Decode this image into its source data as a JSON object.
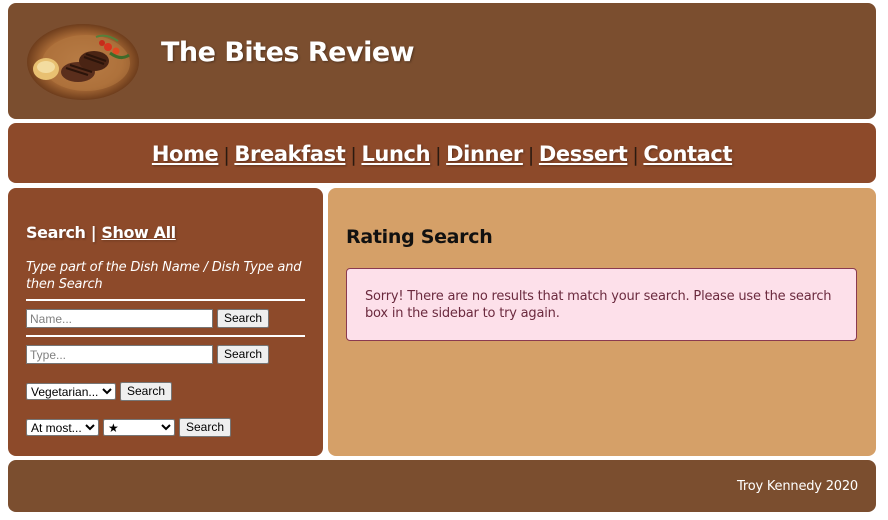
{
  "header": {
    "site_title": "The Bites Review",
    "logo_icon": "steak-plate-logo"
  },
  "nav": {
    "links": [
      "Home",
      "Breakfast",
      "Lunch",
      "Dinner",
      "Dessert",
      "Contact"
    ],
    "separator": "|"
  },
  "sidebar": {
    "heading": "Search",
    "separator": "|",
    "show_all_label": "Show All",
    "instructions": "Type part of the Dish Name / Dish Type and then Search",
    "name_search": {
      "placeholder": "Name...",
      "button_label": "Search"
    },
    "type_search": {
      "placeholder": "Type...",
      "button_label": "Search"
    },
    "diet_search": {
      "selected": "Vegetarian...",
      "button_label": "Search"
    },
    "rating_search": {
      "limit_selected": "At most...",
      "stars_selected": "★",
      "button_label": "Search"
    }
  },
  "main": {
    "title": "Rating Search",
    "alert_message": "Sorry! There are no results that match your search. Please use the search box in the sidebar to try again."
  },
  "footer": {
    "credit": "Troy Kennedy 2020"
  },
  "colors": {
    "header_bg": "#7b4e2f",
    "nav_bg": "#8d4a2a",
    "main_bg": "#d5a068",
    "alert_bg": "#fde0ea",
    "alert_border": "#8a3a50"
  }
}
